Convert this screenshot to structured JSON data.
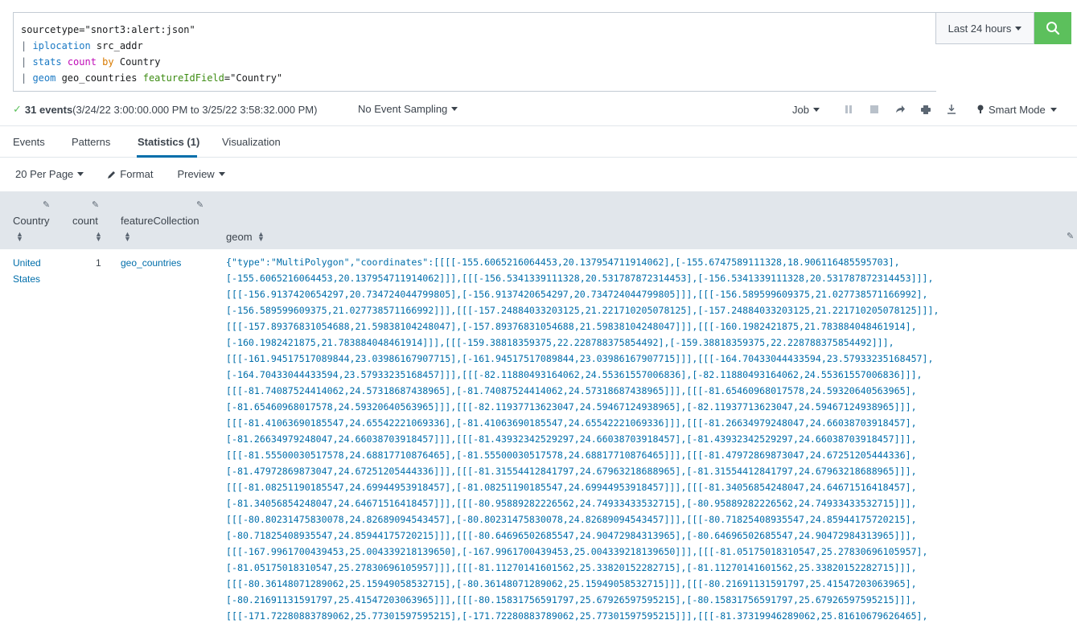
{
  "search": {
    "query_lines": [
      [
        {
          "t": "sourcetype=\"snort3:alert:json\"",
          "c": ""
        }
      ],
      [
        {
          "t": "| ",
          "c": "q-pipe"
        },
        {
          "t": "iplocation",
          "c": "q-cmd"
        },
        {
          "t": " src_addr",
          "c": ""
        }
      ],
      [
        {
          "t": "| ",
          "c": "q-pipe"
        },
        {
          "t": "stats",
          "c": "q-cmd"
        },
        {
          "t": " ",
          "c": ""
        },
        {
          "t": "count",
          "c": "q-fn"
        },
        {
          "t": " ",
          "c": ""
        },
        {
          "t": "by",
          "c": "q-kw"
        },
        {
          "t": " Country",
          "c": ""
        }
      ],
      [
        {
          "t": "| ",
          "c": "q-pipe"
        },
        {
          "t": "geom",
          "c": "q-cmd"
        },
        {
          "t": " geo_countries ",
          "c": ""
        },
        {
          "t": "featureIdField",
          "c": "q-arg"
        },
        {
          "t": "=\"Country\"",
          "c": ""
        }
      ]
    ],
    "time_range": "Last 24 hours",
    "search_icon": "search-icon"
  },
  "status": {
    "event_count": "31 events",
    "time_span": " (3/24/22 3:00:00.000 PM to 3/25/22 3:58:32.000 PM)",
    "sampling": "No Event Sampling",
    "job_label": "Job",
    "mode": "Smart Mode"
  },
  "tabs": [
    {
      "label": "Events",
      "active": false
    },
    {
      "label": "Patterns",
      "active": false
    },
    {
      "label": "Statistics (1)",
      "active": true
    },
    {
      "label": "Visualization",
      "active": false
    }
  ],
  "toolbar": {
    "per_page": "20 Per Page",
    "format": "Format",
    "preview": "Preview"
  },
  "table": {
    "columns": [
      "Country",
      "count",
      "featureCollection",
      "geom"
    ],
    "row": {
      "country": "United States",
      "count": "1",
      "featureCollection": "geo_countries",
      "geom_lines": [
        "{\"type\":\"MultiPolygon\",\"coordinates\":[[[[-155.6065216064453,20.137954711914062],[-155.6747589111328,18.906116485595703],",
        "[-155.6065216064453,20.137954711914062]]],[[[-156.5341339111328,20.531787872314453],[-156.5341339111328,20.531787872314453]]],",
        "[[[-156.9137420654297,20.734724044799805],[-156.9137420654297,20.734724044799805]]],[[[-156.589599609375,21.027738571166992],",
        "[-156.589599609375,21.027738571166992]]],[[[-157.24884033203125,21.221710205078125],[-157.24884033203125,21.221710205078125]]],",
        "[[[-157.89376831054688,21.59838104248047],[-157.89376831054688,21.59838104248047]]],[[[-160.1982421875,21.783884048461914],",
        "[-160.1982421875,21.783884048461914]]],[[[-159.38818359375,22.228788375854492],[-159.38818359375,22.228788375854492]]],",
        "[[[-161.94517517089844,23.03986167907715],[-161.94517517089844,23.03986167907715]]],[[[-164.70433044433594,23.57933235168457],",
        "[-164.70433044433594,23.57933235168457]]],[[[-82.11880493164062,24.55361557006836],[-82.11880493164062,24.55361557006836]]],",
        "[[[-81.74087524414062,24.57318687438965],[-81.74087524414062,24.57318687438965]]],[[[-81.65460968017578,24.59320640563965],",
        "[-81.65460968017578,24.59320640563965]]],[[[-82.11937713623047,24.59467124938965],[-82.11937713623047,24.59467124938965]]],",
        "[[[-81.41063690185547,24.65542221069336],[-81.41063690185547,24.65542221069336]]],[[[-81.26634979248047,24.66038703918457],",
        "[-81.26634979248047,24.66038703918457]]],[[[-81.43932342529297,24.66038703918457],[-81.43932342529297,24.66038703918457]]],",
        "[[[-81.55500030517578,24.68817710876465],[-81.55500030517578,24.68817710876465]]],[[[-81.47972869873047,24.67251205444336],",
        "[-81.47972869873047,24.67251205444336]]],[[[-81.31554412841797,24.67963218688965],[-81.31554412841797,24.67963218688965]]],",
        "[[[-81.08251190185547,24.69944953918457],[-81.08251190185547,24.69944953918457]]],[[[-81.34056854248047,24.64671516418457],",
        "[-81.34056854248047,24.64671516418457]]],[[[-80.95889282226562,24.74933433532715],[-80.95889282226562,24.74933433532715]]],",
        "[[[-80.80231475830078,24.82689094543457],[-80.80231475830078,24.82689094543457]]],[[[-80.71825408935547,24.85944175720215],",
        "[-80.71825408935547,24.85944175720215]]],[[[-80.64696502685547,24.90472984313965],[-80.64696502685547,24.90472984313965]]],",
        "[[[-167.9961700439453,25.004339218139650],[-167.9961700439453,25.004339218139650]]],[[[-81.05175018310547,25.27830696105957],",
        "[-81.05175018310547,25.27830696105957]]],[[[-81.11270141601562,25.33820152282715],[-81.11270141601562,25.33820152282715]]],",
        "[[[-80.36148071289062,25.15949058532715],[-80.36148071289062,25.15949058532715]]],[[[-80.21691131591797,25.41547203063965],",
        "[-80.21691131591797,25.41547203063965]]],[[[-80.15831756591797,25.67926597595215],[-80.15831756591797,25.67926597595215]]],",
        "[[[-171.72280883789062,25.77301597595215],[-171.72280883789062,25.77301597595215]]],[[[-81.37319946289062,25.81610679626465],"
      ]
    }
  }
}
